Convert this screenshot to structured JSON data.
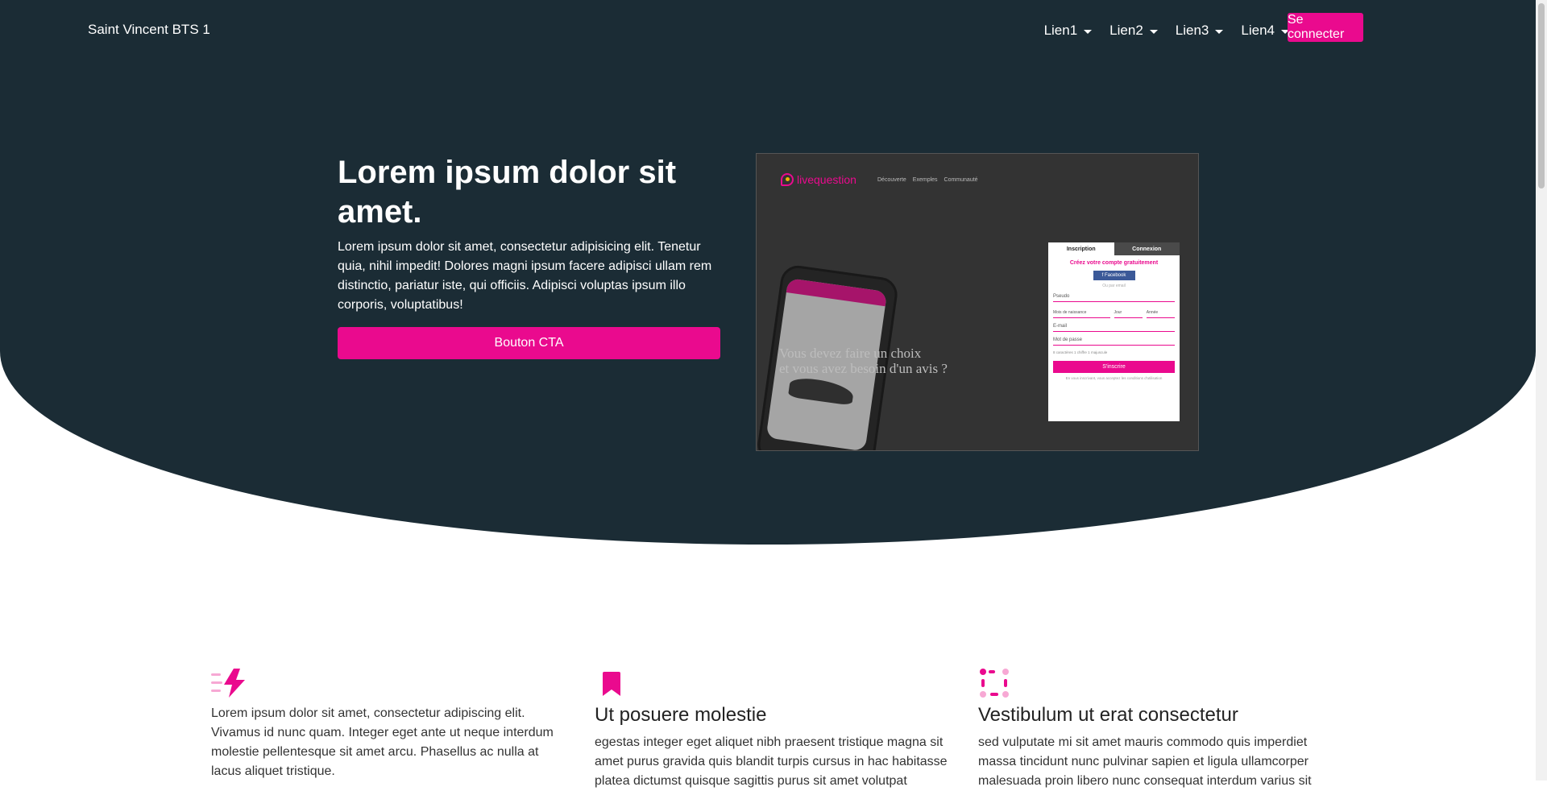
{
  "navbar": {
    "brand": "Saint Vincent BTS 1",
    "links": [
      {
        "label": "Lien1"
      },
      {
        "label": "Lien2"
      },
      {
        "label": "Lien3"
      },
      {
        "label": "Lien4"
      }
    ],
    "login_label": "Se connecter"
  },
  "hero": {
    "title": "Lorem ipsum dolor sit amet.",
    "text": "Lorem ipsum dolor sit amet, consectetur adipisicing elit. Tenetur quia, nihil impedit! Dolores magni ipsum facere adipisci ullam rem distinctio, pariatur iste, qui officiis. Adipisci voluptas ipsum illo corporis, voluptatibus!",
    "cta_label": "Bouton CTA"
  },
  "mockup": {
    "logo_text": "livequestion",
    "menu": [
      "Découverte",
      "Exemples",
      "Communauté"
    ],
    "tagline_1": "Vous devez faire un choix",
    "tagline_2": "et vous avez besoin d'un avis ?",
    "form": {
      "tab_signup": "Inscription",
      "tab_login": "Connexion",
      "heading": "Créez votre compte gratuitement",
      "facebook": "f  Facebook",
      "separator": "Ou par email",
      "pseudo": "Pseudo",
      "birthdate": "Mois de naissance",
      "day": "Jour",
      "year": "Année",
      "email": "E-mail",
      "password": "Mot de passe",
      "checks": "8 caractères   1 chiffre   1 majuscule",
      "submit": "S'inscrire",
      "legal": "En vous inscrivant, vous acceptez les conditions d'utilisation"
    }
  },
  "features": [
    {
      "icon": "lightning-icon",
      "title": "",
      "text": "Lorem ipsum dolor sit amet, consectetur adipiscing elit. Vivamus id nunc quam. Integer eget ante ut neque interdum molestie pellentesque sit amet arcu. Phasellus ac nulla at lacus aliquet tristique."
    },
    {
      "icon": "bookmark-icon",
      "title": "Ut posuere molestie",
      "text": "egestas integer eget aliquet nibh praesent tristique magna sit amet purus gravida quis blandit turpis cursus in hac habitasse platea dictumst quisque sagittis purus sit amet volutpat"
    },
    {
      "icon": "dotted-frame-icon",
      "title": "Vestibulum ut erat consectetur",
      "text": "sed vulputate mi sit amet mauris commodo quis imperdiet massa tincidunt nunc pulvinar sapien et ligula ullamcorper malesuada proin libero nunc consequat interdum varius sit"
    }
  ],
  "colors": {
    "dark": "#1b2c35",
    "accent": "#ea0a8e"
  }
}
